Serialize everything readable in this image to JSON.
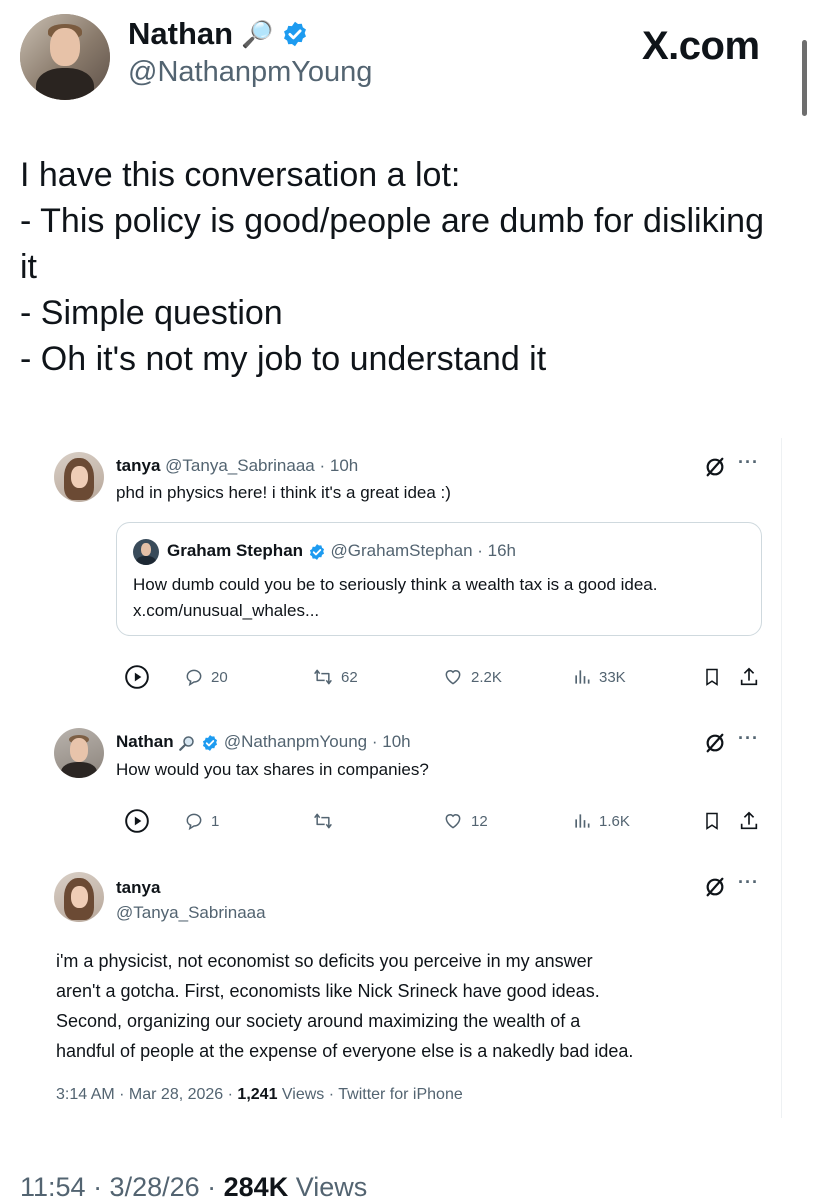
{
  "author": {
    "name": "Nathan",
    "name_emoji": "🔎",
    "handle": "@NathanpmYoung"
  },
  "source_watermark": "X.com",
  "post_lines": [
    "I have this conversation a lot:",
    "- This policy is good/people are dumb for disliking",
    "it",
    "- Simple question",
    "- Oh it's not my job to understand it"
  ],
  "screenshot": {
    "tweet1": {
      "name": "tanya",
      "handle": "@Tanya_Sabrinaaa",
      "time": "· 10h",
      "text": "phd in physics here! i think it's a great idea :)",
      "quoted": {
        "name": "Graham Stephan",
        "handle": "@GrahamStephan",
        "time": "· 16h",
        "text_line1": "How dumb could you be to seriously think a wealth tax is a good idea.",
        "text_line2": "x.com/unusual_whales..."
      },
      "actions": {
        "replies": "20",
        "reposts": "62",
        "likes": "2.2K",
        "views": "33K"
      }
    },
    "tweet2": {
      "name": "Nathan",
      "handle": "@NathanpmYoung",
      "time": "· 10h",
      "text": "How would you tax shares in companies?",
      "actions": {
        "replies": "1",
        "reposts": "",
        "likes": "12",
        "views": "1.6K"
      }
    },
    "tweet3": {
      "name": "tanya",
      "handle": "@Tanya_Sabrinaaa",
      "lines": [
        "i'm a physicist, not economist so deficits you perceive in my answer",
        "aren't a gotcha. First, economists like Nick Srineck have good ideas.",
        "Second, organizing our society around maximizing the wealth of a",
        "handful of people at the expense of everyone else is a nakedly bad idea."
      ],
      "meta_time": "3:14 AM · Mar 28, 2026 · ",
      "meta_views_count": "1,241",
      "meta_views_label": " Views",
      "meta_client": " · Twitter for iPhone"
    }
  },
  "post_meta": {
    "time": "11:54 · 3/28/26 · ",
    "views_count": "284K",
    "views_label": " Views"
  },
  "colors": {
    "verified": "#1d9bf0",
    "text": "#0f1419",
    "muted": "#536471"
  }
}
